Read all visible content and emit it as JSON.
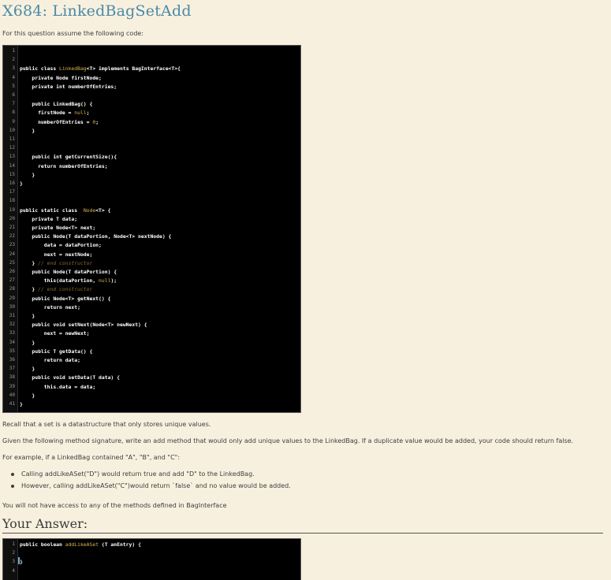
{
  "question": {
    "title": "X684: LinkedBagSetAdd",
    "intro": "For this question assume the following code:",
    "recall": "Recall that a set is a datastructure that only stores unique values.",
    "instructions": "Given the following method signature, write an add method that would only add unique values to the LinkedBag. If a duplicate value would be added, your code should return false.",
    "example_intro": "For example, if a LinkedBag contained \"A\", \"B\", and \"C\":",
    "bullets": [
      "Calling addLikeASet(\"D\") would return true and add \"D\" to the LinkedBag.",
      "However, calling addLikeASet(\"C\")would return `false` and no value would be added."
    ],
    "note": "You will not have access to any of the methods defined in BagInterface"
  },
  "answer": {
    "heading": "Your Answer:"
  },
  "given_code": [
    "",
    "",
    "public class LinkedBag<T> implements BagInterface<T>{",
    "    private Node firstNode;",
    "    private int numberOfEntries;",
    "",
    "    public LinkedBag() {",
    "      firstNode = null;",
    "      numberOfEntries = 0;",
    "    }",
    "",
    "",
    "    public int getCurrentSize(){",
    "      return numberOfEntries;",
    "    }",
    "}",
    "",
    "",
    "public static class  Node<T> {",
    "    private T data;",
    "    private Node<T> next;",
    "    public Node(T dataPortion, Node<T> nextNode) {",
    "        data = dataPortion;",
    "        next = nextNode;",
    "    } // end constructor",
    "    public Node(T dataPortion) {",
    "        this(dataPortion, null);",
    "    } // end constructor",
    "    public Node<T> getNext() {",
    "        return next;",
    "    }",
    "    public void setNext(Node<T> newNext) {",
    "        next = newNext;",
    "    }",
    "    public T getData() {",
    "        return data;",
    "    }",
    "    public void setData(T data) {",
    "        this.data = data;",
    "    }",
    "}"
  ],
  "answer_code": [
    "public boolean addLikeASet (T anEntry) {",
    "",
    "}",
    ""
  ]
}
